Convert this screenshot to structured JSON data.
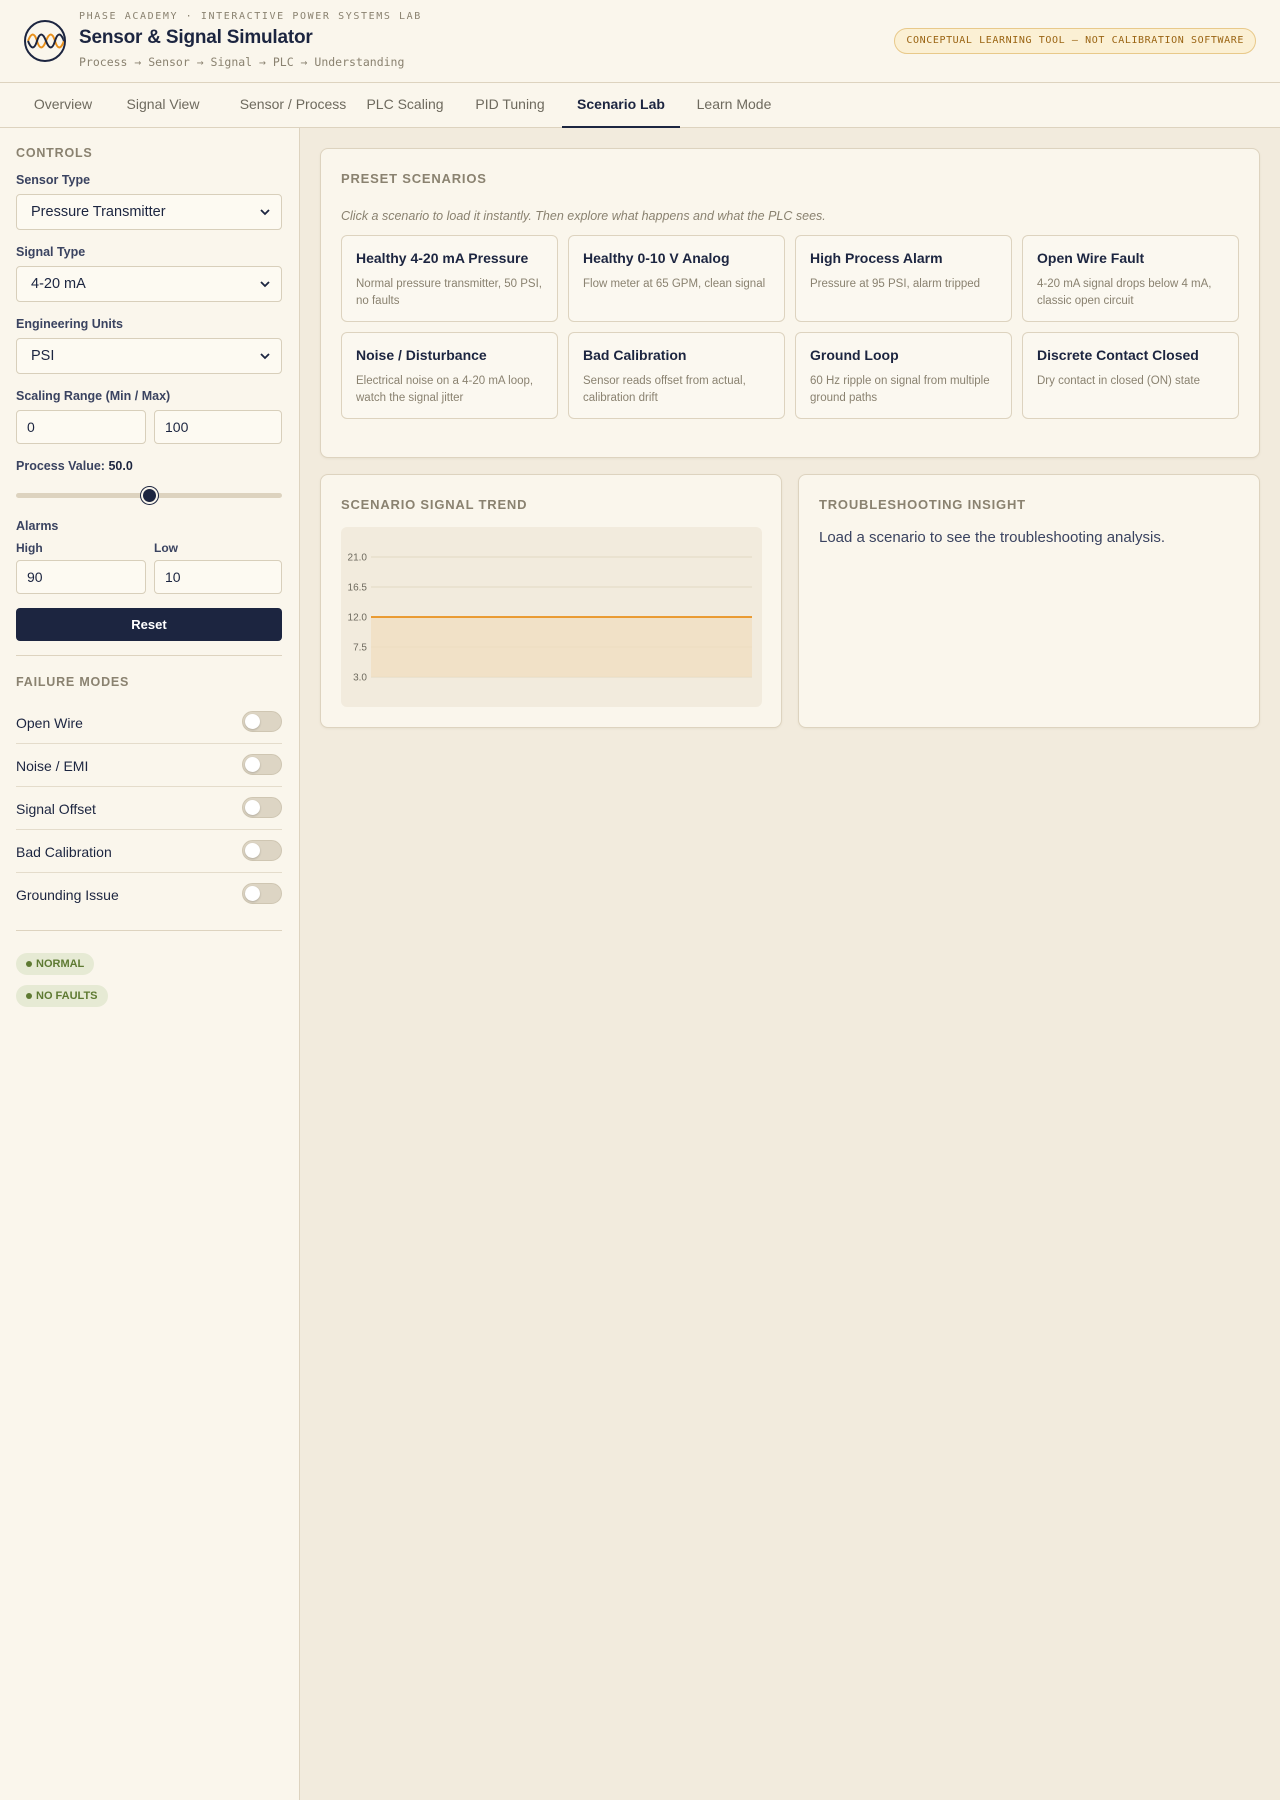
{
  "header": {
    "overline": "PHASE ACADEMY · INTERACTIVE POWER SYSTEMS LAB",
    "title": "Sensor & Signal Simulator",
    "flow": "Process → Sensor → Signal → PLC → Understanding",
    "disclaimer": "CONCEPTUAL LEARNING TOOL — NOT CALIBRATION SOFTWARE",
    "logo_icon": "sine-wave-icon"
  },
  "tabs": [
    {
      "label": "Overview"
    },
    {
      "label": "Signal View"
    },
    {
      "label": "Sensor / Process"
    },
    {
      "label": "PLC Scaling"
    },
    {
      "label": "PID Tuning"
    },
    {
      "label": "Scenario Lab",
      "active": true
    },
    {
      "label": "Learn Mode"
    }
  ],
  "controls": {
    "title": "CONTROLS",
    "sensor_type": {
      "label": "Sensor Type",
      "value": "Pressure Transmitter"
    },
    "signal_type": {
      "label": "Signal Type",
      "value": "4-20 mA"
    },
    "units": {
      "label": "Engineering Units",
      "value": "PSI"
    },
    "range": {
      "label": "Scaling Range (Min / Max)",
      "min": "0",
      "max": "100"
    },
    "process_value": {
      "label": "Process Value:",
      "value": "50.0",
      "fraction": 0.5
    },
    "alarms": {
      "label": "Alarms",
      "high_label": "High",
      "high": "90",
      "low_label": "Low",
      "low": "10"
    },
    "reset_label": "Reset"
  },
  "failure_modes": {
    "title": "FAILURE MODES",
    "items": [
      {
        "label": "Open Wire",
        "on": false
      },
      {
        "label": "Noise / EMI",
        "on": false
      },
      {
        "label": "Signal Offset",
        "on": false
      },
      {
        "label": "Bad Calibration",
        "on": false
      },
      {
        "label": "Grounding Issue",
        "on": false
      }
    ]
  },
  "status": {
    "state": "NORMAL",
    "faults": "NO FAULTS",
    "color": "#5e7a32"
  },
  "presets": {
    "title": "PRESET SCENARIOS",
    "hint": "Click a scenario to load it instantly. Then explore what happens and what the PLC sees.",
    "items": [
      {
        "name": "Healthy 4-20 mA Pressure",
        "desc": "Normal pressure transmitter, 50 PSI, no faults"
      },
      {
        "name": "Healthy 0-10 V Analog",
        "desc": "Flow meter at 65 GPM, clean signal"
      },
      {
        "name": "High Process Alarm",
        "desc": "Pressure at 95 PSI, alarm tripped"
      },
      {
        "name": "Open Wire Fault",
        "desc": "4-20 mA signal drops below 4 mA, classic open circuit"
      },
      {
        "name": "Noise / Disturbance",
        "desc": "Electrical noise on a 4-20 mA loop, watch the signal jitter"
      },
      {
        "name": "Bad Calibration",
        "desc": "Sensor reads offset from actual, calibration drift"
      },
      {
        "name": "Ground Loop",
        "desc": "60 Hz ripple on signal from multiple ground paths"
      },
      {
        "name": "Discrete Contact Closed",
        "desc": "Dry contact in closed (ON) state"
      }
    ]
  },
  "trend": {
    "title": "SCENARIO SIGNAL TREND"
  },
  "insight": {
    "title": "TROUBLESHOOTING INSIGHT",
    "text": "Load a scenario to see the troubleshooting analysis."
  },
  "colors": {
    "accent": "#1c2540",
    "trend_line": "#e8901c",
    "trend_fill": "#f0dfc2"
  },
  "chart_data": {
    "type": "area",
    "title": "",
    "xlabel": "",
    "ylabel": "",
    "ylim": [
      3.0,
      21.0
    ],
    "yticks": [
      "21.0",
      "16.5",
      "12.0",
      "7.5",
      "3.0"
    ],
    "x": [
      0,
      1,
      2,
      3,
      4,
      5,
      6,
      7,
      8,
      9,
      10
    ],
    "series": [
      {
        "values": [
          12.0,
          12.0,
          12.0,
          12.0,
          12.0,
          12.0,
          12.0,
          12.0,
          12.0,
          12.0,
          12.0
        ]
      }
    ],
    "grid": true
  }
}
